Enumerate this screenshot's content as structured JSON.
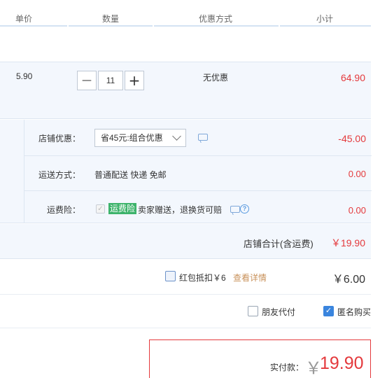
{
  "header": {
    "col_price": "单价",
    "col_qty": "数量",
    "col_promo": "优惠方式",
    "col_subtotal": "小计"
  },
  "item": {
    "unit_price": "5.90",
    "minus": "—",
    "quantity": "11",
    "plus": "+",
    "promo": "无优惠",
    "subtotal": "64.90"
  },
  "shop": {
    "discount_label": "店铺优惠：",
    "discount_select": "省45元:组合优惠",
    "discount_amount": "-45.00",
    "shipping_label": "运送方式：",
    "shipping_value": "普通配送 快递 免邮",
    "shipping_amount": "0.00",
    "insurance_label": "运费险：",
    "insurance_badge": "运费险",
    "insurance_desc": "卖家赠送，退换货可赔",
    "insurance_amount": "0.00",
    "total_label": "店铺合计(含运费)",
    "total_value": "￥19.90"
  },
  "coupon": {
    "label": "红包抵扣￥6",
    "details_link": "查看详情",
    "amount": "￥6.00"
  },
  "payment_options": {
    "friend_pay": "朋友代付",
    "anonymous": "匿名购买"
  },
  "final": {
    "label": "实付款：",
    "currency": "￥",
    "amount": "19.90"
  },
  "colors": {
    "price_red": "#e4393c",
    "badge_green": "#3db36b",
    "accent_blue": "#3a85de",
    "link_orange": "#c8915a"
  }
}
